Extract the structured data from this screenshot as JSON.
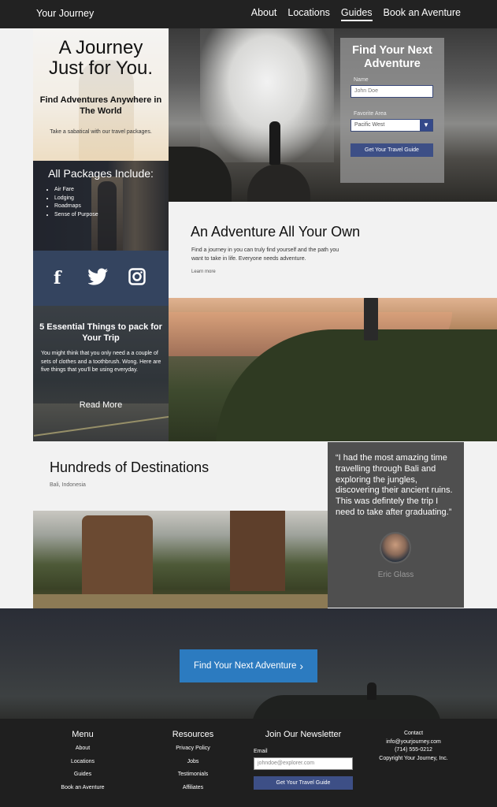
{
  "nav": {
    "brand": "Your Journey",
    "links": [
      "About",
      "Locations",
      "Guides",
      "Book an Aventure"
    ],
    "active": "Guides"
  },
  "hero": {
    "title_line1": "A Journey",
    "title_line2": "Just for You.",
    "subtitle": "Find Adventures Anywhere in The World",
    "note": "Take a sabatical with our travel packages."
  },
  "form": {
    "title": "Find Your Next Adventure",
    "name_label": "Name",
    "name_value": "John Doe",
    "area_label": "Favorite Area",
    "area_value": "Pacific West",
    "button": "Get Your Travel Guide"
  },
  "packages": {
    "title": "All Packages Include:",
    "items": [
      "Air Fare",
      "Lodging",
      "Roadmaps",
      "Sense of Purpose"
    ]
  },
  "social": {
    "facebook": "f"
  },
  "essentials": {
    "title": "5 Essential Things to pack for Your Trip",
    "body": "You might think that you only need a a couple of sets of clothes and a toothbrush. Wong. Here are five things that you'll be using everyday.",
    "read_more": "Read More"
  },
  "adventure": {
    "title": "An Adventure All Your Own",
    "body": "Find a journey in you can truly find yourself and the path you want to take in life. Everyone needs adventure.",
    "link": "Learn more"
  },
  "destinations": {
    "title": "Hundreds of Destinations",
    "location": "Bali, Indonesia"
  },
  "testimonial": {
    "quote": "“I had the most amazing time travelling through Bali and exploring the jungles, discovering their ancient ruins. This was defintely the trip I need to take after graduating.”",
    "author": "Eric Glass"
  },
  "cta": {
    "label": "Find Your Next Adventure",
    "chevron": "›"
  },
  "footer": {
    "menu": {
      "title": "Menu",
      "links": [
        "About",
        "Locations",
        "Guides",
        "Book an Aventure"
      ]
    },
    "resources": {
      "title": "Resources",
      "links": [
        "Privacy Policy",
        "Jobs",
        "Testimonials",
        "Affiliates"
      ]
    },
    "newsletter": {
      "title": "Join Our Newsletter",
      "email_label": "Email",
      "placeholder": "johndoe@explorer.com",
      "button": "Get Your Travel Guide"
    },
    "contact": {
      "title": "Contact",
      "email": "info@yourjourney.com",
      "phone": "(714) 555-0212",
      "copyright": "Copyright Your Journey, Inc."
    }
  },
  "colors": {
    "nav_bg": "#222222",
    "accent_blue": "#2c7bc0",
    "form_button": "#3d4f86",
    "social_bg": "#34445f",
    "testimonial_bg": "#4f4f4f"
  }
}
